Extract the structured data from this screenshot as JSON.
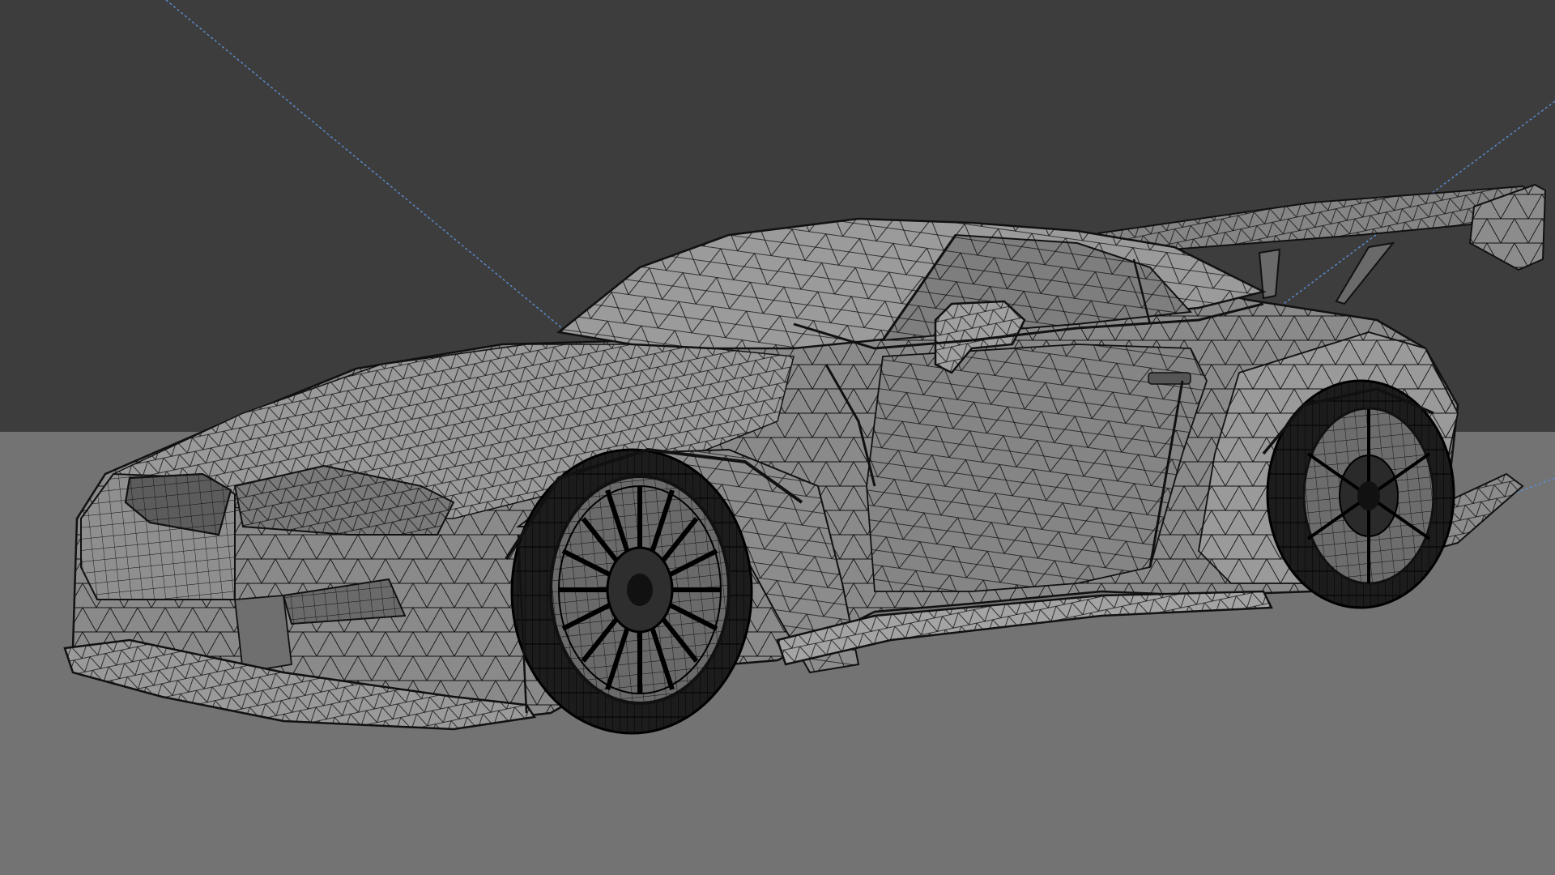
{
  "viewport": {
    "mode": "wireframe-overlay",
    "colors": {
      "backdrop": "#3d3d3d",
      "ground": "#737373",
      "body_fill": "#8a8a8a",
      "body_fill_light": "#a2a2a2",
      "body_fill_dark": "#6f6f6f",
      "wire": "#111111",
      "tire": "#1c1c1c",
      "light_guide": "#5b8fd4"
    }
  },
  "scene": {
    "object": {
      "name": "car-mesh",
      "icon": "car-icon",
      "parts": [
        "body",
        "greenhouse",
        "rear-wing",
        "front-wheel",
        "rear-wheel",
        "side-mirror",
        "front-splitter",
        "side-skirt",
        "rear-diffuser"
      ]
    },
    "light_guides": 3
  }
}
